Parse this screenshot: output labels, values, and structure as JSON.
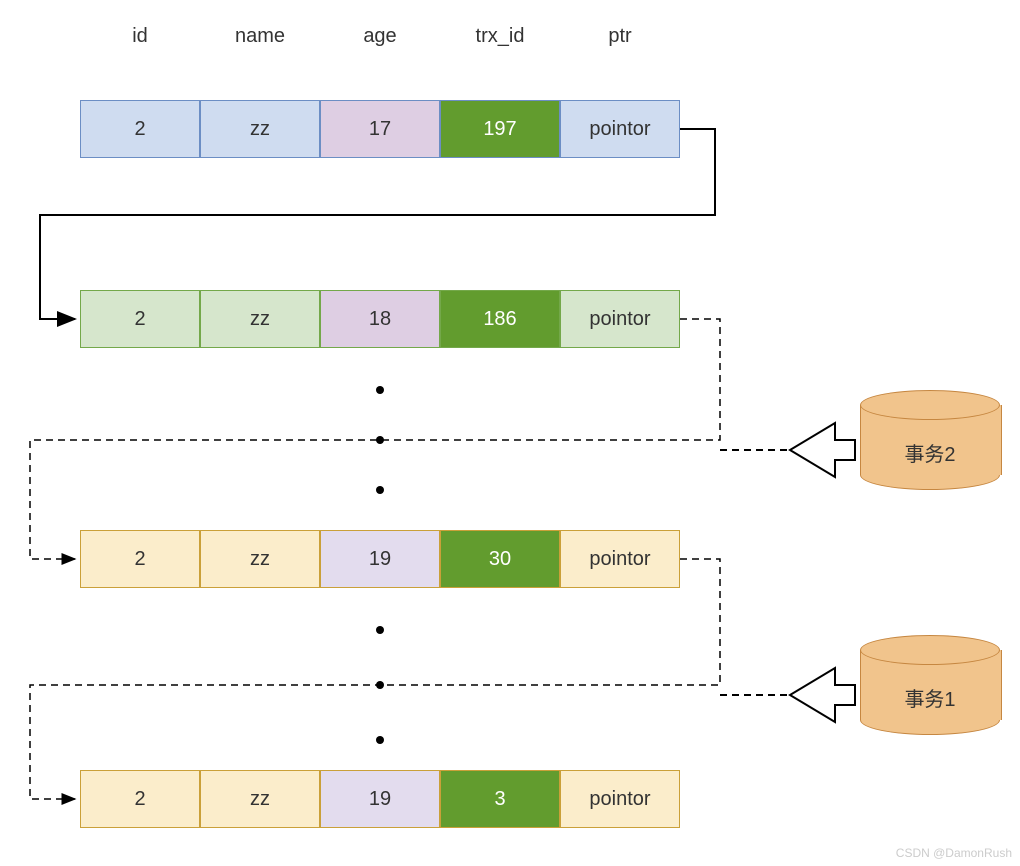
{
  "headers": {
    "id": "id",
    "name": "name",
    "age": "age",
    "trx_id": "trx_id",
    "ptr": "ptr"
  },
  "rows": {
    "r0": {
      "id": "2",
      "name": "zz",
      "age": "17",
      "trx": "197",
      "ptr": "pointor"
    },
    "r1": {
      "id": "2",
      "name": "zz",
      "age": "18",
      "trx": "186",
      "ptr": "pointor"
    },
    "r2": {
      "id": "2",
      "name": "zz",
      "age": "19",
      "trx": "30",
      "ptr": "pointor"
    },
    "r3": {
      "id": "2",
      "name": "zz",
      "age": "19",
      "trx": "3",
      "ptr": "pointor"
    }
  },
  "db": {
    "t1": "事务1",
    "t2": "事务2"
  },
  "watermark": "CSDN @DamonRush"
}
